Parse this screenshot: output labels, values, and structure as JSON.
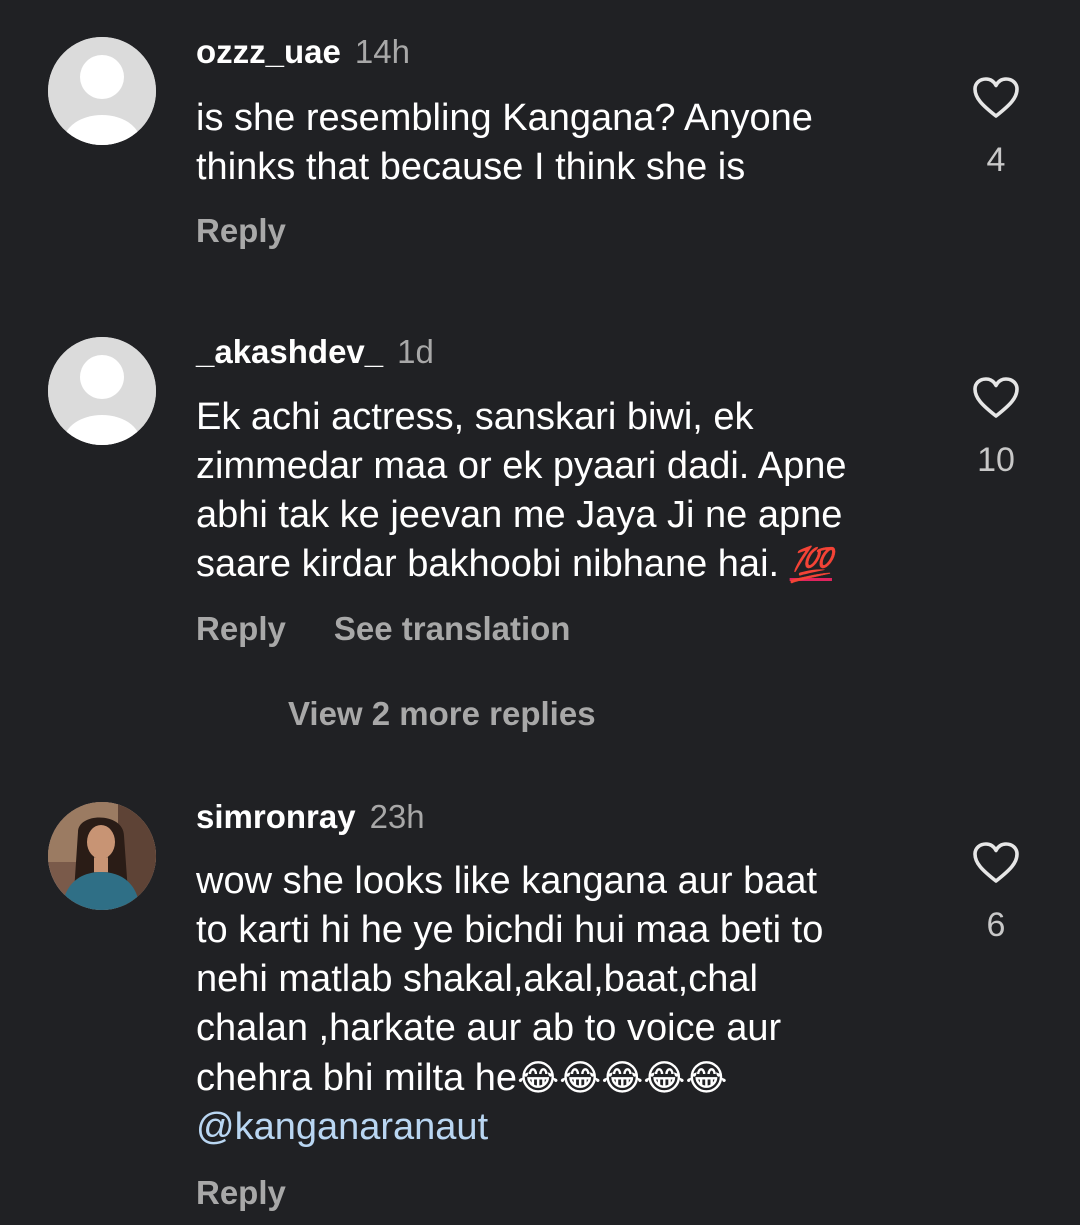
{
  "comments": [
    {
      "username": "ozzz_uae",
      "time": "14h",
      "text_lines": [
        "is she resembling Kangana? Anyone",
        "thinks that because I think she is"
      ],
      "likes": "4",
      "reply_label": "Reply"
    },
    {
      "username": "_akashdev_",
      "time": "1d",
      "text_lines": [
        "Ek achi actress, sanskari biwi, ek",
        "zimmedar maa or ek pyaari dadi. Apne",
        "abhi tak ke jeevan me Jaya Ji ne apne",
        "saare kirdar bakhoobi nibhane hai."
      ],
      "emoji": "💯",
      "likes": "10",
      "reply_label": "Reply",
      "translation_label": "See translation",
      "view_replies_label": "View 2 more replies"
    },
    {
      "username": "simronray",
      "time": "23h",
      "text_lines": [
        "wow she looks like kangana aur baat",
        "to karti hi he ye bichdi hui maa beti to",
        "nehi matlab shakal,akal,baat,chal",
        "chalan ,harkate aur ab to voice aur",
        "chehra bhi milta he"
      ],
      "emoji": "😂😂😂😂😂",
      "mention": "@kanganaranaut",
      "likes": "6",
      "reply_label": "Reply"
    }
  ],
  "icons": {
    "like": "heart-outline-icon",
    "default_avatar": "default-avatar-icon"
  },
  "colors": {
    "background": "#202124",
    "text": "#ffffff",
    "secondary": "#a8a8a8",
    "mention": "#b9d6f2"
  }
}
